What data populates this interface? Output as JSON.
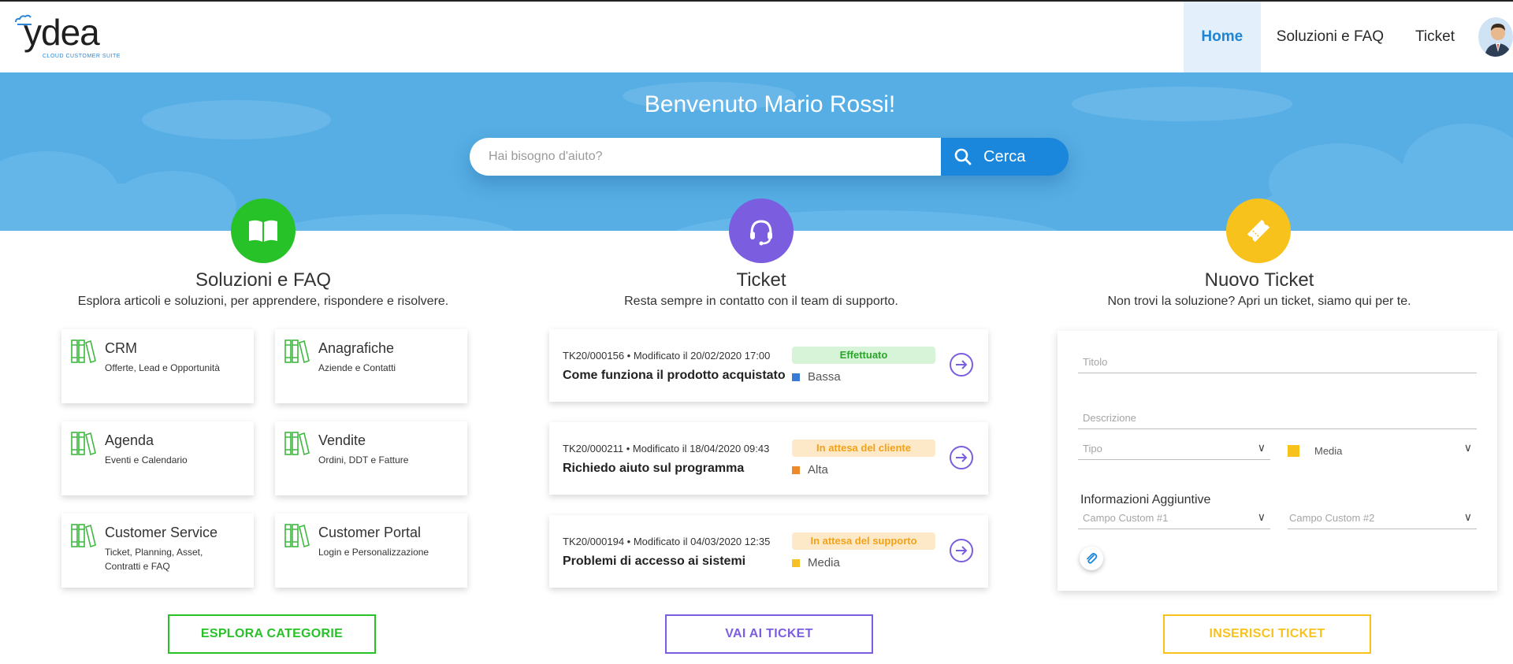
{
  "logo": {
    "word": "ydea",
    "tagline": "CLOUD CUSTOMER SUITE"
  },
  "nav": {
    "home": "Home",
    "solutions": "Soluzioni e FAQ",
    "ticket": "Ticket"
  },
  "hero": {
    "title": "Benvenuto Mario Rossi!",
    "search_placeholder": "Hai bisogno d'aiuto?",
    "search_button": "Cerca"
  },
  "solutions": {
    "title": "Soluzioni e FAQ",
    "subtitle": "Esplora articoli e soluzioni, per apprendere, rispondere e risolvere.",
    "categories": [
      {
        "title": "CRM",
        "subtitle": "Offerte, Lead e Opportunità"
      },
      {
        "title": "Anagrafiche",
        "subtitle": "Aziende e Contatti"
      },
      {
        "title": "Agenda",
        "subtitle": "Eventi e Calendario"
      },
      {
        "title": "Vendite",
        "subtitle": "Ordini, DDT e Fatture"
      },
      {
        "title": "Customer Service",
        "subtitle": "Ticket, Planning, Asset, Contratti e FAQ"
      },
      {
        "title": "Customer Portal",
        "subtitle": "Login e Personalizzazione"
      }
    ],
    "button": "ESPLORA CATEGORIE"
  },
  "tickets": {
    "title": "Ticket",
    "subtitle": "Resta sempre in contatto con il team di supporto.",
    "items": [
      {
        "meta": "TK20/000156 • Modificato  il 20/02/2020 17:00",
        "subject": "Come funziona il prodotto acquistato",
        "status": "Effettuato",
        "priority": "Bassa"
      },
      {
        "meta": "TK20/000211 • Modificato il 18/04/2020 09:43",
        "subject": "Richiedo aiuto sul programma",
        "status": "In attesa del cliente",
        "priority": "Alta"
      },
      {
        "meta": "TK20/000194 • Modificato il 04/03/2020 12:35",
        "subject": "Problemi di accesso ai sistemi",
        "status": "In attesa del supporto",
        "priority": "Media"
      }
    ],
    "button": "VAI AI TICKET"
  },
  "new_ticket": {
    "title": "Nuovo Ticket",
    "subtitle": "Non trovi la soluzione? Apri un ticket, siamo qui per te.",
    "form": {
      "title_placeholder": "Titolo",
      "description_placeholder": "Descrizione",
      "type_placeholder": "Tipo",
      "priority_value": "Media",
      "extra_label": "Informazioni Aggiuntive",
      "custom1_placeholder": "Campo Custom #1",
      "custom2_placeholder": "Campo Custom #2"
    },
    "button": "INSERISCI TICKET"
  },
  "colors": {
    "accent_blue": "#1a87dc",
    "hero_blue": "#56aee4",
    "green": "#27c227",
    "purple": "#7b5ee0",
    "yellow": "#f8c21d",
    "status_done_bg": "#d8f4d8",
    "status_done_fg": "#2aa52a",
    "status_wait_bg": "#fde9c7",
    "status_wait_fg": "#f0a21a",
    "prio_low": "#3b7bd8",
    "prio_high": "#ee8a2a",
    "prio_medium": "#f5c028"
  }
}
